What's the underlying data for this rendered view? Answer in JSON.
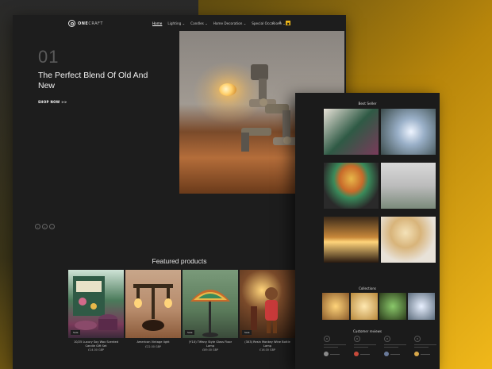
{
  "brand": {
    "name_bold": "ONE",
    "name_light": "CRAFT"
  },
  "nav": {
    "items": [
      {
        "label": "Home",
        "active": true
      },
      {
        "label": "Lighting ⌄",
        "active": false
      },
      {
        "label": "Candles ⌄",
        "active": false
      },
      {
        "label": "Home Decoration ⌄",
        "active": false
      },
      {
        "label": "Special Occasions ⌄",
        "active": false
      }
    ],
    "icons": [
      "search-icon",
      "user-icon",
      "cart-icon"
    ]
  },
  "hero": {
    "number": "01",
    "title": "The Perfect Blend Of Old And New",
    "cta": "SHOP NOW >>",
    "dots": [
      "‹",
      "•",
      "›"
    ]
  },
  "featured": {
    "title": "Featured products",
    "products": [
      {
        "name": "10/25 Luxury Soy Wax Scented Candle Gift Set",
        "price": "£14.00 GBP",
        "badge": "Sale"
      },
      {
        "name": "American Vintage light",
        "price": "£22.00 GBP",
        "badge": ""
      },
      {
        "name": "(Y1X) Tiffany Style Glass Floor Lamp",
        "price": "£89.00 GBP",
        "badge": "Sale"
      },
      {
        "name": "(3X3) Resin Monkey Wine Bottle Lamp",
        "price": "£16.00 GBP",
        "badge": "Sale"
      }
    ]
  },
  "mobile": {
    "best_seller": "Best Seller",
    "collections": "Collections",
    "reviews": "Customer reviews"
  },
  "colors": {
    "accent": "#f0b81a",
    "panel": "#1d1d1d",
    "background_gradient_end": "#f0b81a"
  }
}
